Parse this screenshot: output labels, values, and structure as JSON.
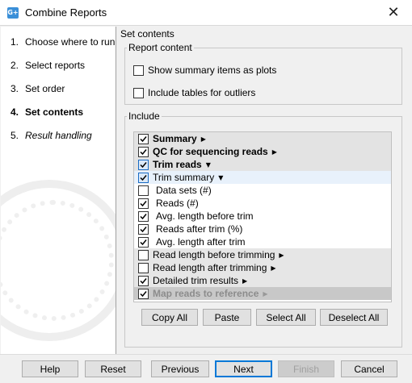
{
  "window": {
    "title": "Combine Reports",
    "app_icon_text": "G+"
  },
  "steps": [
    {
      "num": "1.",
      "label": "Choose where to run"
    },
    {
      "num": "2.",
      "label": "Select reports"
    },
    {
      "num": "3.",
      "label": "Set order"
    },
    {
      "num": "4.",
      "label": "Set contents"
    },
    {
      "num": "5.",
      "label": "Result handling"
    }
  ],
  "content": {
    "section_title": "Set contents",
    "report_content": {
      "legend": "Report content",
      "show_summary_label": "Show summary items as plots",
      "show_summary_checked": false,
      "include_outliers_label": "Include tables for outliers",
      "include_outliers_checked": false
    },
    "include": {
      "legend": "Include",
      "rows": [
        {
          "label": "Summary",
          "checked": true,
          "arrow": "▶"
        },
        {
          "label": "QC for sequencing reads",
          "checked": true,
          "arrow": "▶"
        },
        {
          "label": "Trim reads",
          "checked": true,
          "arrow": "▼"
        },
        {
          "label": "Trim summary",
          "checked": true,
          "arrow": "▼"
        },
        {
          "label": "Data sets (#)",
          "checked": false
        },
        {
          "label": "Reads (#)",
          "checked": true
        },
        {
          "label": "Avg. length before trim",
          "checked": true
        },
        {
          "label": "Reads after trim (%)",
          "checked": true
        },
        {
          "label": "Avg. length after trim",
          "checked": true
        },
        {
          "label": "Read length before trimming",
          "checked": false,
          "arrow": "▶"
        },
        {
          "label": "Read length after trimming",
          "checked": false,
          "arrow": "▶"
        },
        {
          "label": "Detailed trim results",
          "checked": true,
          "arrow": "▶"
        },
        {
          "label": "Map reads to reference",
          "checked": true,
          "arrow": "▶"
        }
      ],
      "buttons": {
        "copy_all": "Copy All",
        "paste": "Paste",
        "select_all": "Select All",
        "deselect_all": "Deselect All"
      }
    }
  },
  "footer": {
    "help": "Help",
    "reset": "Reset",
    "previous": "Previous",
    "next": "Next",
    "finish": "Finish",
    "cancel": "Cancel"
  },
  "colors": {
    "accent": "#0078d7",
    "checkbox_highlight": "#1a6bc4"
  }
}
